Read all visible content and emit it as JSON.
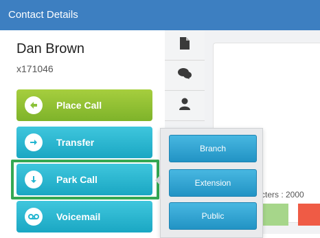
{
  "window": {
    "title": "Contact Details"
  },
  "contact": {
    "name": "Dan Brown",
    "extension": "x171046"
  },
  "actions": [
    {
      "label": "Place Call",
      "icon": "place-call-icon",
      "color": "#8cc23a"
    },
    {
      "label": "Transfer",
      "icon": "arrow-right-icon",
      "color": "#22b5d0"
    },
    {
      "label": "Park Call",
      "icon": "arrow-down-icon",
      "color": "#22b5d0"
    },
    {
      "label": "Voicemail",
      "icon": "voicemail-icon",
      "color": "#22b5d0"
    }
  ],
  "tabs": [
    {
      "icon": "document-icon"
    },
    {
      "icon": "chat-icon"
    },
    {
      "icon": "person-icon"
    }
  ],
  "park_menu": {
    "options": [
      "Branch",
      "Extension",
      "Public"
    ]
  },
  "notes": {
    "chars_text": "cters : 2000"
  },
  "colors": {
    "header": "#3d7fc1",
    "highlight": "#34a853",
    "accent_red": "#ef5b45",
    "accent_green": "#a6d68a"
  }
}
